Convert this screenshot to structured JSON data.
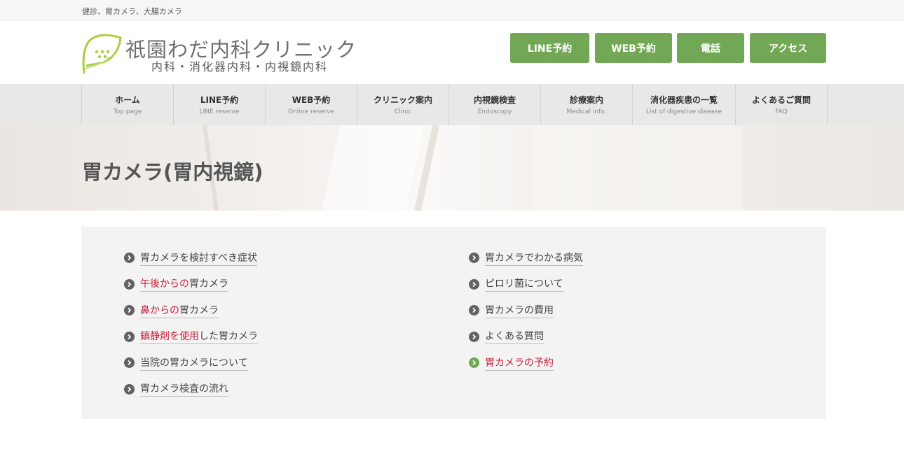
{
  "topbar": {
    "text": "健診、胃カメラ、大腸カメラ"
  },
  "logo": {
    "title": "祇園わだ内科クリニック",
    "subtitle": "内科・消化器内科・内視鏡内科"
  },
  "header_buttons": {
    "line": "LINE予約",
    "web": "WEB予約",
    "tel": "電話",
    "access": "アクセス"
  },
  "colors": {
    "accent_green": "#72a855",
    "highlight_red": "#c8203c",
    "logo_green": "#a9cf3d"
  },
  "nav": [
    {
      "label": "ホーム",
      "sub": "Top page"
    },
    {
      "label": "LINE予約",
      "sub": "LINE reserve"
    },
    {
      "label": "WEB予約",
      "sub": "Online reserve"
    },
    {
      "label": "クリニック案内",
      "sub": "Clinic"
    },
    {
      "label": "内視鏡検査",
      "sub": "Endoscopy"
    },
    {
      "label": "診療案内",
      "sub": "Medical info."
    },
    {
      "label": "消化器疾患の一覧",
      "sub": "List of digestive disease"
    },
    {
      "label": "よくあるご質問",
      "sub": "FAQ"
    }
  ],
  "hero": {
    "title": "胃カメラ(胃内視鏡)"
  },
  "toc": {
    "left": [
      {
        "hl": "",
        "text": "胃カメラを検討すべき症状"
      },
      {
        "hl": "午後からの",
        "text": "胃カメラ"
      },
      {
        "hl": "鼻からの",
        "text": "胃カメラ"
      },
      {
        "hl": "鎮静剤を使用",
        "text": "した胃カメラ"
      },
      {
        "hl": "",
        "text": "当院の胃カメラについて"
      },
      {
        "hl": "",
        "text": "胃カメラ検査の流れ"
      }
    ],
    "right": [
      {
        "hl": "",
        "text": "胃カメラでわかる病気"
      },
      {
        "hl": "",
        "text": "ピロリ菌について"
      },
      {
        "hl": "",
        "text": "胃カメラの費用"
      },
      {
        "hl": "",
        "text": "よくある質問"
      },
      {
        "hl": "胃カメラの予約",
        "text": ""
      }
    ]
  }
}
